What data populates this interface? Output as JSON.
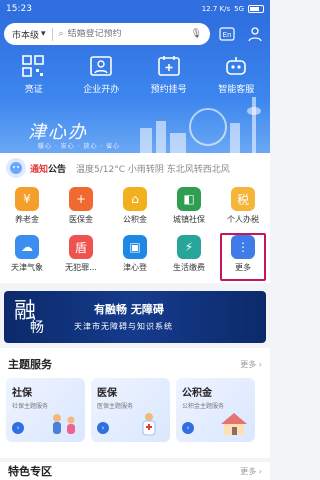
{
  "status": {
    "time": "15:23",
    "net": "12.7 K/s",
    "battery": "5G"
  },
  "search": {
    "city": "市本级",
    "placeholder": "结婚登记预约"
  },
  "quick": [
    {
      "label": "亮证"
    },
    {
      "label": "企业开办"
    },
    {
      "label": "预约挂号"
    },
    {
      "label": "智能客服"
    }
  ],
  "hero": {
    "slogan": "津心办",
    "sub": "暖心 · 安心 · 放心 · 省心"
  },
  "notice": {
    "tag_red": "通知",
    "tag_rest": "公告",
    "message": "温度5/12°C 小雨转阴 东北风转西北风"
  },
  "services": [
    {
      "label": "养老金",
      "color": "#f59f2a",
      "glyph": "¥"
    },
    {
      "label": "医保金",
      "color": "#f0692e",
      "glyph": "+"
    },
    {
      "label": "公积金",
      "color": "#f2b01e",
      "glyph": "⌂"
    },
    {
      "label": "城镇社保",
      "color": "#2f9e52",
      "glyph": "◧"
    },
    {
      "label": "个人办税",
      "color": "#f5b43a",
      "glyph": "税"
    },
    {
      "label": "天津气象",
      "color": "#3b8df0",
      "glyph": "☁"
    },
    {
      "label": "无犯罪...",
      "color": "#ef5350",
      "glyph": "盾"
    },
    {
      "label": "津心登",
      "color": "#1e88e5",
      "glyph": "▣"
    },
    {
      "label": "生活缴费",
      "color": "#26a69a",
      "glyph": "⚡"
    },
    {
      "label": "更多",
      "color": "#3f7ce8",
      "glyph": "⋮"
    }
  ],
  "banner": {
    "big": "融",
    "big2": "畅",
    "line1": "有融畅 无障碍",
    "line2": "天津市无障碍与知识系统"
  },
  "theme": {
    "title": "主题服务",
    "more": "更多 ›",
    "cards": [
      {
        "title": "社保",
        "sub": "社保主题服务"
      },
      {
        "title": "医保",
        "sub": "医保主题服务"
      },
      {
        "title": "公积金",
        "sub": "公积金主题服务"
      }
    ]
  },
  "special": {
    "title": "特色专区",
    "more": "更多 ›"
  }
}
